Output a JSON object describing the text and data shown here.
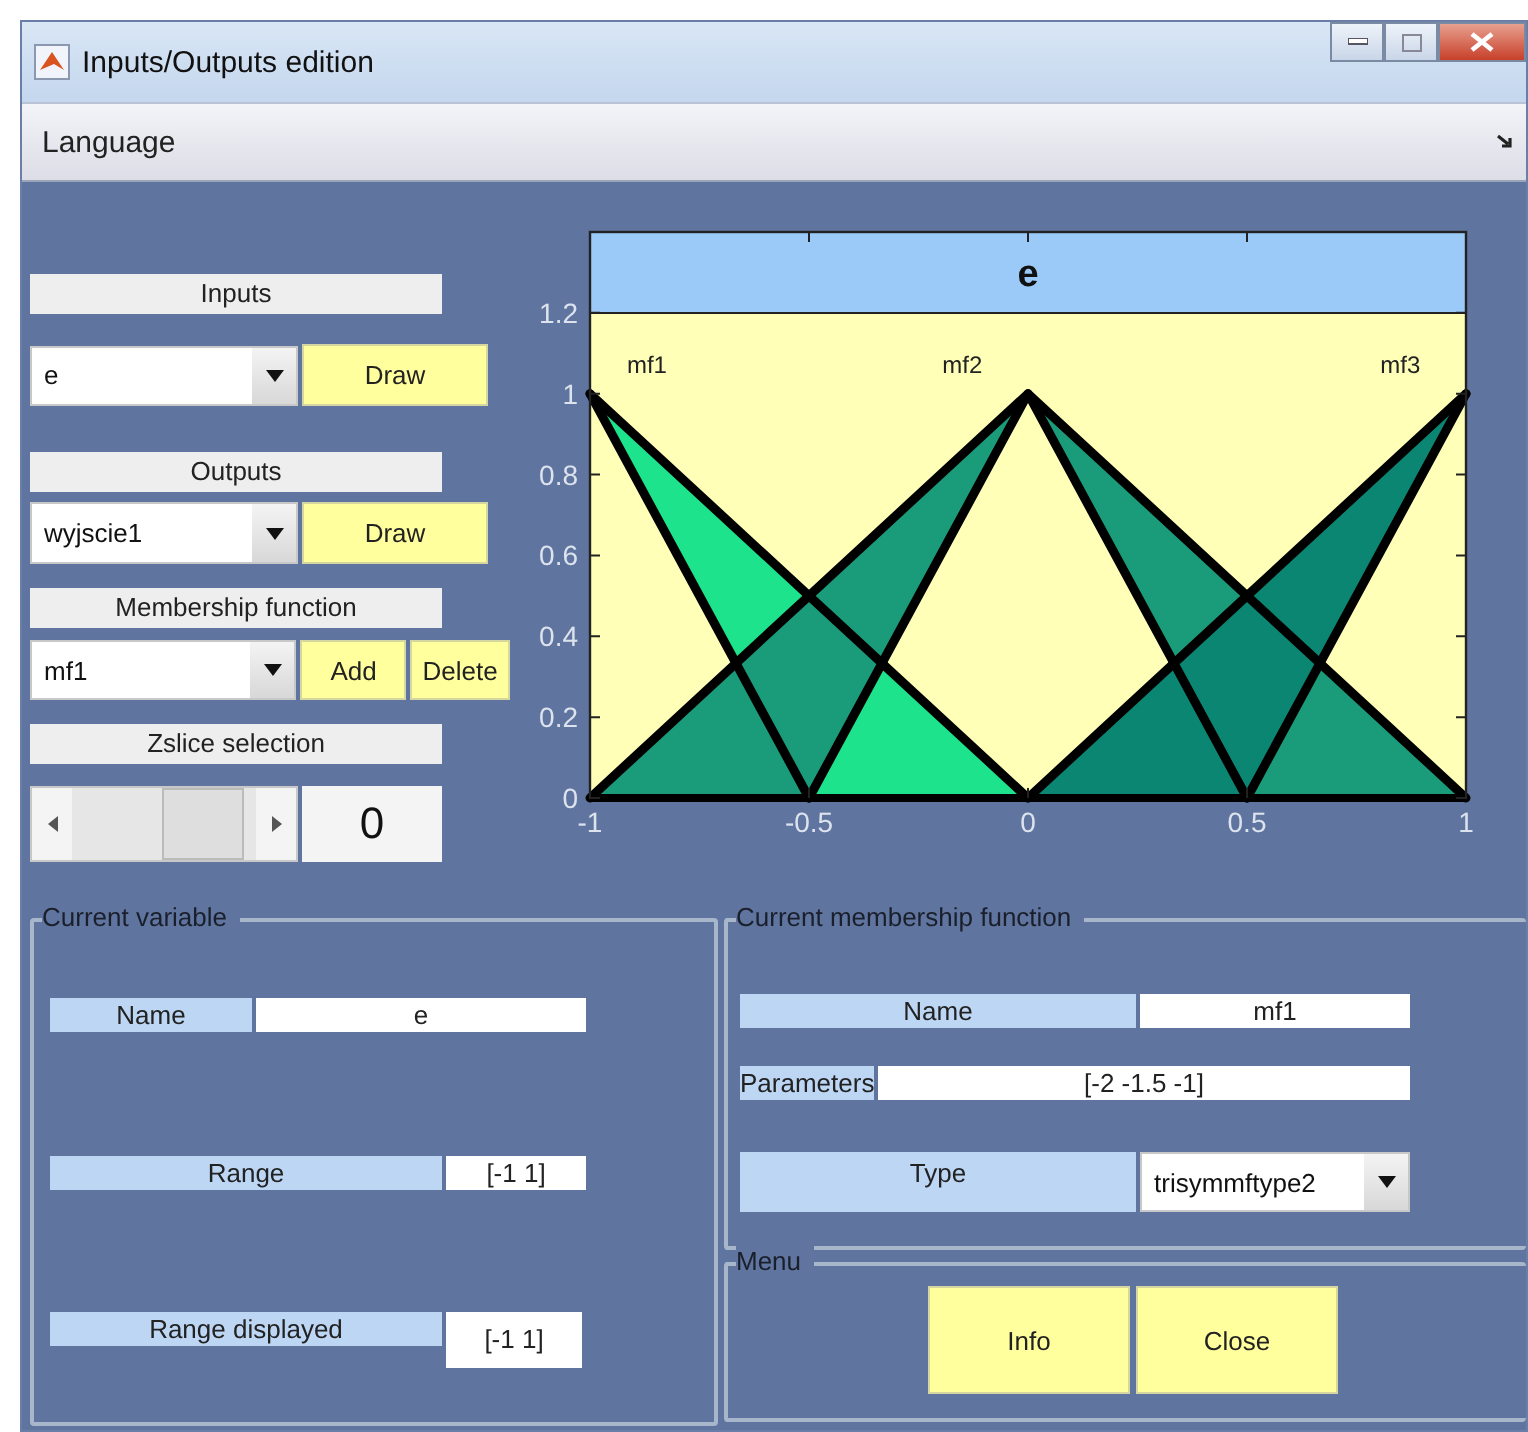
{
  "window": {
    "title": "Inputs/Outputs edition",
    "menu": [
      "Language"
    ]
  },
  "inputs": {
    "label": "Inputs",
    "value": "e",
    "button": "Draw"
  },
  "outputs": {
    "label": "Outputs",
    "value": "wyjscie1",
    "button": "Draw"
  },
  "membership_function": {
    "label": "Membership function",
    "value": "mf1",
    "buttons": [
      "Add",
      "Delete"
    ]
  },
  "zslice": {
    "label": "Zslice selection",
    "level": 0.88,
    "value": "0"
  },
  "plot": {
    "fills": [
      {
        "color": "#1de38c"
      },
      {
        "color": "#1a9c7a"
      },
      {
        "color": "#0b8673"
      }
    ],
    "chart_data": {
      "type": "line",
      "title": "e",
      "x": [
        -1,
        -0.5,
        0,
        0.5,
        1
      ],
      "series": [
        {
          "name": "mf1",
          "color": "#000000",
          "values": [
            1,
            0.5,
            0,
            null,
            null
          ]
        },
        {
          "color": "#000000",
          "values": [
            1,
            0,
            null,
            null,
            null
          ]
        },
        {
          "name": "mf2",
          "color": "#000000",
          "values": [
            0,
            0.5,
            1,
            0.5,
            0
          ]
        },
        {
          "color": "#000000",
          "values": [
            null,
            0,
            1,
            0,
            null
          ]
        },
        {
          "name": "mf3",
          "color": "#000000",
          "values": [
            null,
            null,
            0,
            0.5,
            1
          ]
        },
        {
          "color": "#000000",
          "values": [
            null,
            null,
            null,
            0,
            1
          ]
        }
      ],
      "xlim": [
        -1,
        1
      ],
      "ylim": [
        0,
        1.4
      ],
      "xticks": [
        {
          "value": -1,
          "label": "-1"
        },
        {
          "value": -0.5,
          "label": "-0.5"
        },
        {
          "value": 0,
          "label": "0"
        },
        {
          "value": 0.5,
          "label": "0.5"
        },
        {
          "value": 1,
          "label": "1"
        }
      ],
      "yticks": [
        {
          "value": 0,
          "label": "0"
        },
        {
          "value": 0.2,
          "label": "0.2"
        },
        {
          "value": 0.4,
          "label": "0.4"
        },
        {
          "value": 0.6,
          "label": "0.6"
        },
        {
          "value": 0.8,
          "label": "0.8"
        },
        {
          "value": 1,
          "label": "1"
        },
        {
          "value": 1.2,
          "label": "1.2"
        }
      ]
    }
  },
  "current_variable": {
    "title": "Current variable",
    "fields": [
      {
        "label": "Name",
        "value": "e"
      },
      {
        "label": "Range",
        "value": "[-1  1]"
      },
      {
        "label": "Range displayed",
        "value": "[-1  1]"
      }
    ]
  },
  "current_membership_function": {
    "title": "Current membership function",
    "name": {
      "label": "Name",
      "value": "mf1"
    },
    "parameters": {
      "label": "Parameters",
      "value": "[-2 -1.5 -1]"
    },
    "type": {
      "label": "Type",
      "value": "trisymmftype2"
    }
  },
  "menu": {
    "title": "Menu",
    "buttons": [
      "Info",
      "Close"
    ]
  }
}
